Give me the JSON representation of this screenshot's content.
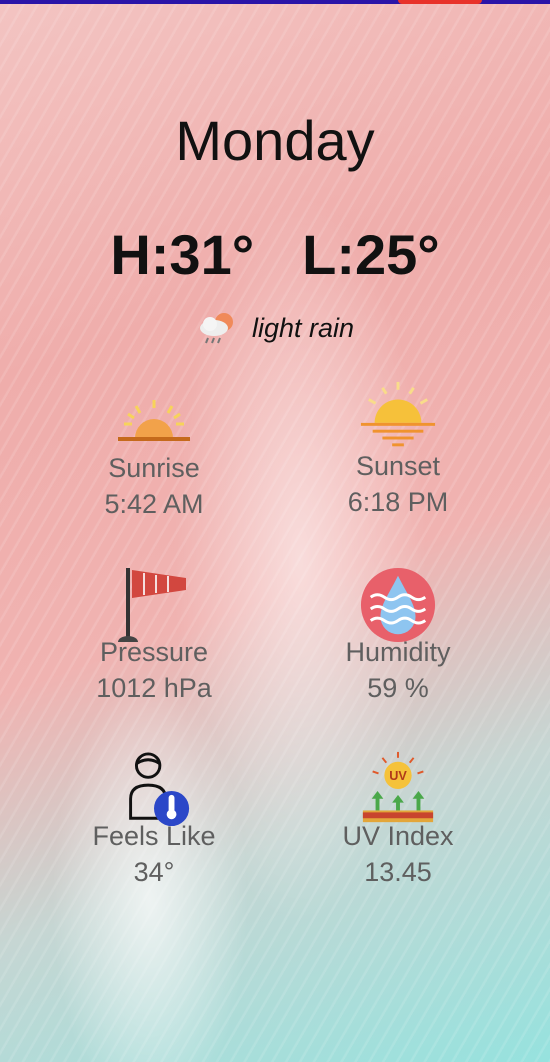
{
  "day": "Monday",
  "high": "H:31°",
  "low": "L:25°",
  "condition": {
    "icon": "cloud-rain-sun-icon",
    "text": "light rain"
  },
  "details": [
    {
      "icon": "sunrise-icon",
      "label": "Sunrise",
      "value": "5:42 AM"
    },
    {
      "icon": "sunset-icon",
      "label": "Sunset",
      "value": "6:18 PM"
    },
    {
      "icon": "windsock-icon",
      "label": "Pressure",
      "value": "1012 hPa"
    },
    {
      "icon": "humidity-icon",
      "label": "Humidity",
      "value": "59 %"
    },
    {
      "icon": "feels-like-icon",
      "label": "Feels Like",
      "value": "34°"
    },
    {
      "icon": "uv-index-icon",
      "label": "UV Index",
      "value": "13.45",
      "badge": "UV"
    }
  ],
  "colors": {
    "topbar": "#2a14a8",
    "pill": "#e8322a"
  }
}
